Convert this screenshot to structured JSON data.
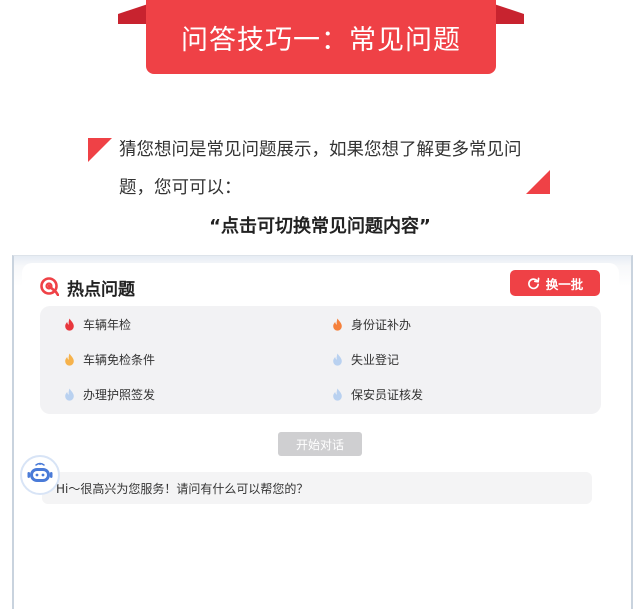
{
  "banner": {
    "title": "问答技巧一：常见问题"
  },
  "intro": {
    "text": "猜您想问是常见问题展示，如果您想了解更多常见问题，您可可以：",
    "cta": "“点击可切换常见问题内容”"
  },
  "hot": {
    "title": "热点问题",
    "refresh_label": "换一批",
    "topics": [
      {
        "label": "车辆年检",
        "icon": "flame-red-icon"
      },
      {
        "label": "身份证补办",
        "icon": "flame-orange-icon"
      },
      {
        "label": "车辆免检条件",
        "icon": "flame-yellow-icon"
      },
      {
        "label": "失业登记",
        "icon": "flame-blue-icon"
      },
      {
        "label": "办理护照签发",
        "icon": "flame-blue-icon"
      },
      {
        "label": "保安员证核发",
        "icon": "flame-blue-icon"
      }
    ]
  },
  "chat": {
    "start_label": "开始对话",
    "greeting": "Hi～很高兴为您服务！请问有什么可以帮您的？"
  },
  "colors": {
    "accent": "#ef4146",
    "flame_red": "#e8373d",
    "flame_orange": "#f5803b",
    "flame_yellow": "#f6b24b",
    "flame_blue": "#b9d1f0"
  }
}
